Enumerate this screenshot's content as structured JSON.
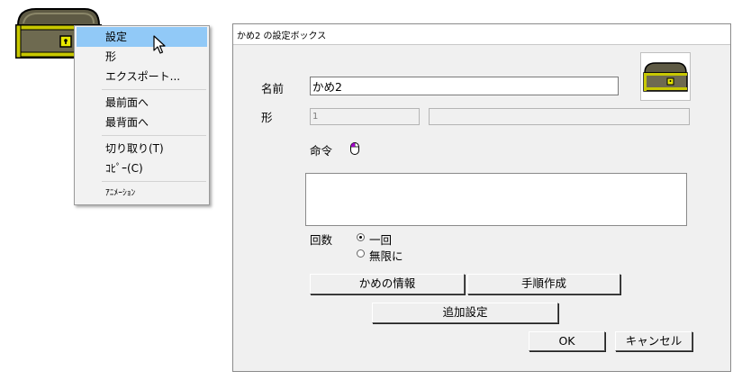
{
  "context_menu": {
    "items": [
      {
        "label": "設定"
      },
      {
        "label": "形"
      },
      {
        "label": "エクスポート..."
      },
      {
        "label": "最前面へ"
      },
      {
        "label": "最背面へ"
      },
      {
        "label": "切り取り(T)"
      },
      {
        "label": "ｺﾋﾟｰ(C)"
      },
      {
        "label": "ｱﾆﾒｰｼｮﾝ"
      }
    ],
    "highlighted_index": 0
  },
  "dialog": {
    "title": "かめ2 の設定ボックス",
    "name_label": "名前",
    "name_value": "かめ2",
    "shape_label": "形",
    "shape_number": "1",
    "shape_name": "",
    "command_label": "命令",
    "count_label": "回数",
    "radio_once": "一回",
    "radio_infinite": "無限に",
    "selected_count": "once",
    "kame_info_button": "かめの情報",
    "procedure_button": "手順作成",
    "additional_button": "追加設定",
    "ok_button": "OK",
    "cancel_button": "キャンセル"
  },
  "icons": {
    "desktop_object": "treasure-chest-icon",
    "preview": "treasure-chest-icon",
    "command": "mouse-icon",
    "cursor": "arrow-cursor-icon"
  },
  "colors": {
    "menu_highlight": "#91c9f7",
    "chest_body": "#6e6a50",
    "chest_trim": "#c8c800",
    "mouse_icon": "#a000c8"
  }
}
